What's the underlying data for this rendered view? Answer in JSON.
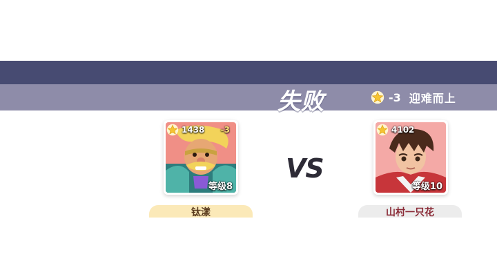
{
  "result": {
    "title": "失败",
    "star_delta": "-3",
    "caption": "迎难而上"
  },
  "vs_label": "VS",
  "players": {
    "left": {
      "rating": "1438",
      "delta": "-3",
      "level": "等级8",
      "name": "钛漾"
    },
    "right": {
      "rating": "4102",
      "level": "等级10",
      "name": "山村一只花"
    }
  },
  "colors": {
    "band_dark": "#474b72",
    "band_light": "#8e8ca9",
    "star": "#f5c431",
    "left_name_bg": "#fbe9b8",
    "right_name_bg": "#ececec"
  }
}
